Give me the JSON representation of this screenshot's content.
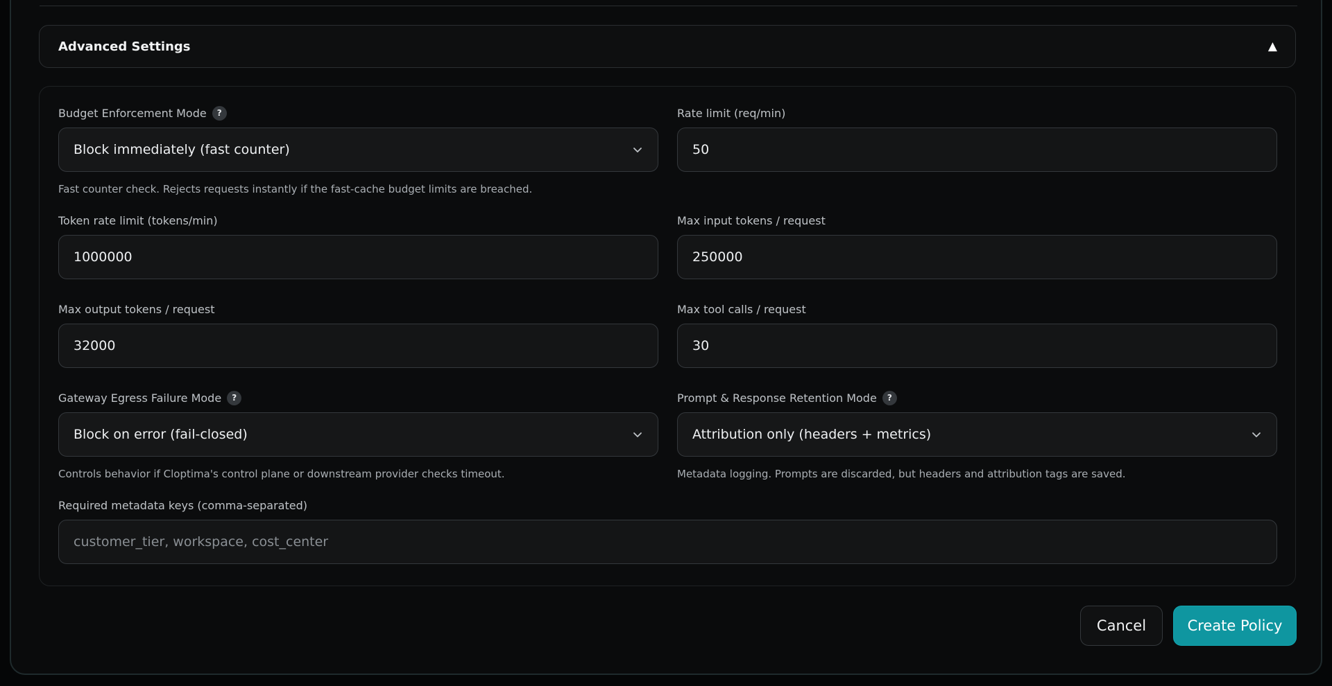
{
  "advanced": {
    "title": "Advanced Settings",
    "toggle_icon": "▲"
  },
  "fields": {
    "budget_mode": {
      "label": "Budget Enforcement Mode",
      "value": "Block immediately (fast counter)",
      "hint": "Fast counter check. Rejects requests instantly if the fast-cache budget limits are breached."
    },
    "rate_limit": {
      "label": "Rate limit (req/min)",
      "value": "50"
    },
    "token_rate_limit": {
      "label": "Token rate limit (tokens/min)",
      "value": "1000000"
    },
    "max_input_tokens": {
      "label": "Max input tokens / request",
      "value": "250000"
    },
    "max_output_tokens": {
      "label": "Max output tokens / request",
      "value": "32000"
    },
    "max_tool_calls": {
      "label": "Max tool calls / request",
      "value": "30"
    },
    "egress_failure_mode": {
      "label": "Gateway Egress Failure Mode",
      "value": "Block on error (fail-closed)",
      "hint": "Controls behavior if Cloptima's control plane or downstream provider checks timeout."
    },
    "retention_mode": {
      "label": "Prompt & Response Retention Mode",
      "value": "Attribution only (headers + metrics)",
      "hint": "Metadata logging. Prompts are discarded, but headers and attribution tags are saved."
    },
    "metadata_keys": {
      "label": "Required metadata keys (comma-separated)",
      "placeholder": "customer_tier, workspace, cost_center"
    }
  },
  "help_icon_glyph": "?",
  "buttons": {
    "cancel": "Cancel",
    "create": "Create Policy"
  },
  "colors": {
    "accent": "#0f96a0",
    "background": "#0a0b0c"
  }
}
